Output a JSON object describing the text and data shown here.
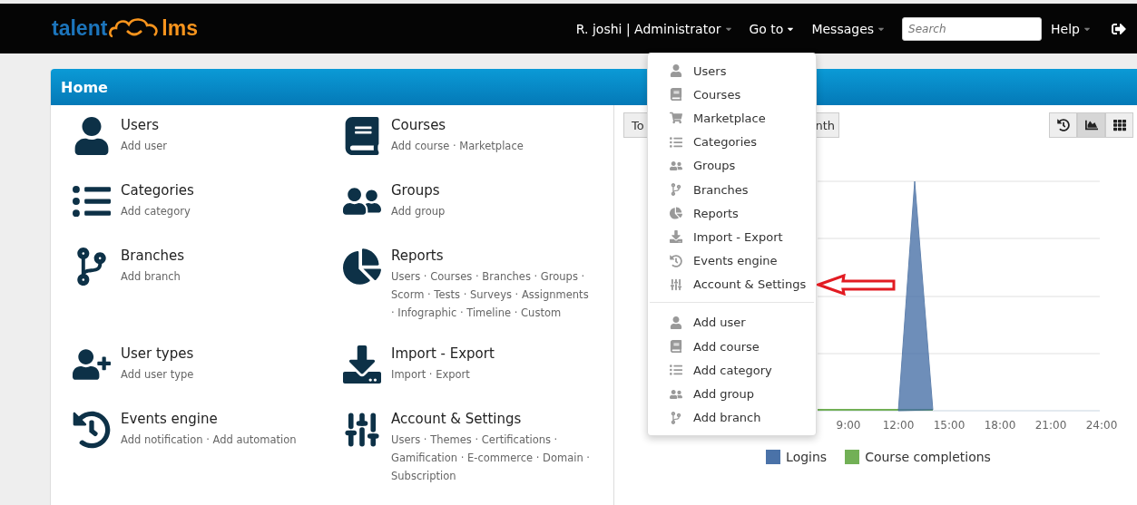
{
  "logo": {
    "word_1": "talent",
    "word_2": "lms"
  },
  "top_nav": [
    {
      "label": "R. joshi | Administrator",
      "expanded": false
    },
    {
      "label": "Go to",
      "expanded": true
    },
    {
      "label": "Messages",
      "expanded": false
    }
  ],
  "search": {
    "placeholder": "Search"
  },
  "help": {
    "label": "Help",
    "expanded": false
  },
  "panel": {
    "title": "Home"
  },
  "sections": [
    {
      "title": "Users",
      "links": "Add user"
    },
    {
      "title": "Courses",
      "links": "Add course · Marketplace"
    },
    {
      "title": "Categories",
      "links": "Add category"
    },
    {
      "title": "Groups",
      "links": "Add group"
    },
    {
      "title": "Branches",
      "links": "Add branch"
    },
    {
      "title": "Reports",
      "links": "Users · Courses · Branches · Groups · Scorm · Tests · Surveys · Assignments · Infographic · Timeline · Custom"
    },
    {
      "title": "User types",
      "links": "Add user type"
    },
    {
      "title": "Import - Export",
      "links": "Import · Export"
    },
    {
      "title": "Events engine",
      "links": "Add notification · Add automation"
    },
    {
      "title": "Account & Settings",
      "links": "Users · Themes · Certifications · Gamification · E-commerce · Domain · Subscription"
    }
  ],
  "period_buttons": [
    {
      "label": "To"
    },
    {
      "label": "nth"
    }
  ],
  "view_buttons": [
    {
      "selected": false
    },
    {
      "selected": true
    },
    {
      "selected": false
    }
  ],
  "chart": {
    "x_labels": [
      "9:00",
      "12:00",
      "15:00",
      "18:00",
      "21:00",
      "24:00"
    ],
    "legend": [
      {
        "label": "Logins",
        "color": "#4a72a8"
      },
      {
        "label": "Course completions",
        "color": "#72b056"
      }
    ]
  },
  "goto_menu": {
    "items": [
      {
        "label": "Users"
      },
      {
        "label": "Courses"
      },
      {
        "label": "Marketplace"
      },
      {
        "label": "Categories"
      },
      {
        "label": "Groups"
      },
      {
        "label": "Branches"
      },
      {
        "label": "Reports"
      },
      {
        "label": "Import - Export"
      },
      {
        "label": "Events engine"
      },
      {
        "label": "Account & Settings"
      }
    ],
    "add_items": [
      {
        "label": "Add user"
      },
      {
        "label": "Add course"
      },
      {
        "label": "Add category"
      },
      {
        "label": "Add group"
      },
      {
        "label": "Add branch"
      }
    ]
  }
}
